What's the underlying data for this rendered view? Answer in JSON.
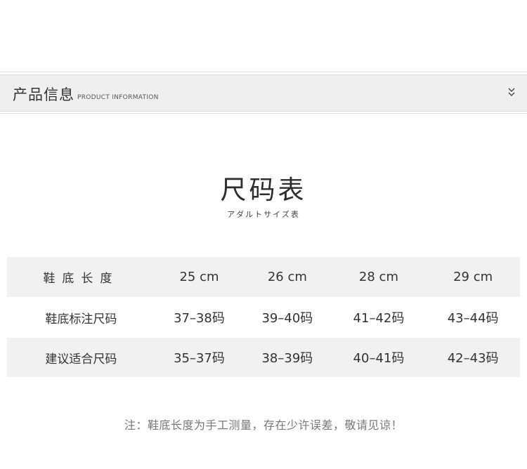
{
  "section_bar": {
    "title": "产品信息",
    "subtitle": "PRODUCT INFORMATION",
    "icon": "chevron-double-down-icon"
  },
  "heading": "尺码表",
  "subheading": "アダルトサイズ表",
  "size_table": {
    "rows": [
      {
        "label": "鞋底长度",
        "values": [
          "25 cm",
          "26 cm",
          "28 cm",
          "29 cm"
        ]
      },
      {
        "label": "鞋底标注尺码",
        "values": [
          "37–38码",
          "39–40码",
          "41–42码",
          "43–44码"
        ]
      },
      {
        "label": "建议适合尺码",
        "values": [
          "35–37码",
          "38–39码",
          "40–41码",
          "42–43码"
        ]
      }
    ]
  },
  "note": "注：鞋底长度为手工测量，存在少许误差，敬请见谅！",
  "colors": {
    "bar_background": "#efefef",
    "row_shade": "#f1f1f1",
    "text": "#333333",
    "note_text": "#777777"
  }
}
